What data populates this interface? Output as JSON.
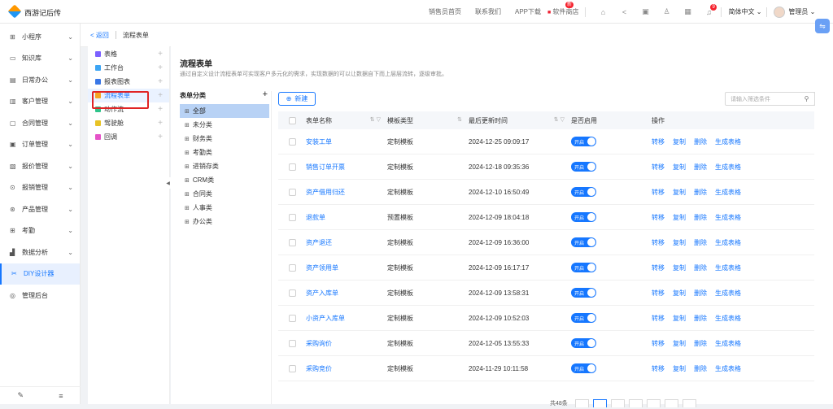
{
  "app": {
    "title": "西游记后传"
  },
  "topnav": {
    "links": [
      "销售员首页",
      "联系我们",
      "APP下载",
      "软件商店"
    ],
    "app_badge": "新",
    "notif_count": "9",
    "language": "简体中文",
    "user": "管理员"
  },
  "sidebar": {
    "items": [
      {
        "label": "小程序",
        "icon": "grid-icon"
      },
      {
        "label": "知识库",
        "icon": "book-icon"
      },
      {
        "label": "日常办公",
        "icon": "calendar-icon"
      },
      {
        "label": "客户管理",
        "icon": "customer-icon"
      },
      {
        "label": "合同管理",
        "icon": "contract-icon"
      },
      {
        "label": "订单管理",
        "icon": "order-icon"
      },
      {
        "label": "报价管理",
        "icon": "quote-icon"
      },
      {
        "label": "报销管理",
        "icon": "expense-icon"
      },
      {
        "label": "产品管理",
        "icon": "product-icon"
      },
      {
        "label": "考勤",
        "icon": "attendance-icon"
      },
      {
        "label": "数据分析",
        "icon": "chart-icon"
      },
      {
        "label": "DIY设计器",
        "icon": "diy-icon"
      },
      {
        "label": "管理后台",
        "icon": "admin-icon"
      }
    ]
  },
  "breadcrumb": {
    "back": "返回",
    "current": "流程表单"
  },
  "leftpanel": {
    "items": [
      {
        "label": "表格",
        "color": "#7b61ff"
      },
      {
        "label": "工作台",
        "color": "#3da5f4"
      },
      {
        "label": "报表图表",
        "color": "#3977e6"
      },
      {
        "label": "流程表单",
        "color": "#f5a623"
      },
      {
        "label": "动作流",
        "color": "#2ec48a"
      },
      {
        "label": "驾驶舱",
        "color": "#e8c326"
      },
      {
        "label": "回调",
        "color": "#e553c8"
      }
    ]
  },
  "page": {
    "title": "流程表单",
    "desc": "通过自定义设计流程表单可实现客户多元化的需求，实现数据的可以让数据自下而上层层流转，逐级审批。"
  },
  "categories": {
    "header": "表单分类",
    "items": [
      "全部",
      "未分类",
      "财务类",
      "考勤类",
      "进销存类",
      "CRM类",
      "合同类",
      "人事类",
      "办公类"
    ]
  },
  "toolbar": {
    "new_label": "新建",
    "search_placeholder": "请输入筛选条件"
  },
  "table": {
    "headers": [
      "表单名称",
      "模板类型",
      "最后更新时间",
      "是否启用",
      "操作"
    ],
    "toggle_label": "开启",
    "actions": [
      "转移",
      "复制",
      "删除",
      "生成表格"
    ],
    "rows": [
      {
        "name": "安装工单",
        "type": "定制模板",
        "time": "2024-12-25 09:09:17"
      },
      {
        "name": "销售订单开票",
        "type": "定制模板",
        "time": "2024-12-18 09:35:36"
      },
      {
        "name": "资产借用归还",
        "type": "定制模板",
        "time": "2024-12-10 16:50:49"
      },
      {
        "name": "退款单",
        "type": "预置模板",
        "time": "2024-12-09 18:04:18"
      },
      {
        "name": "资产退还",
        "type": "定制模板",
        "time": "2024-12-09 16:36:00"
      },
      {
        "name": "资产领用单",
        "type": "定制模板",
        "time": "2024-12-09 16:17:17"
      },
      {
        "name": "资产入库单",
        "type": "定制模板",
        "time": "2024-12-09 13:58:31"
      },
      {
        "name": "小资产入库单",
        "type": "定制模板",
        "time": "2024-12-09 10:52:03"
      },
      {
        "name": "采购询价",
        "type": "定制模板",
        "time": "2024-12-05 13:55:33"
      },
      {
        "name": "采购竞价",
        "type": "定制模板",
        "time": "2024-11-29 10:11:58"
      }
    ]
  },
  "pagination": {
    "total_label": "共48条"
  }
}
